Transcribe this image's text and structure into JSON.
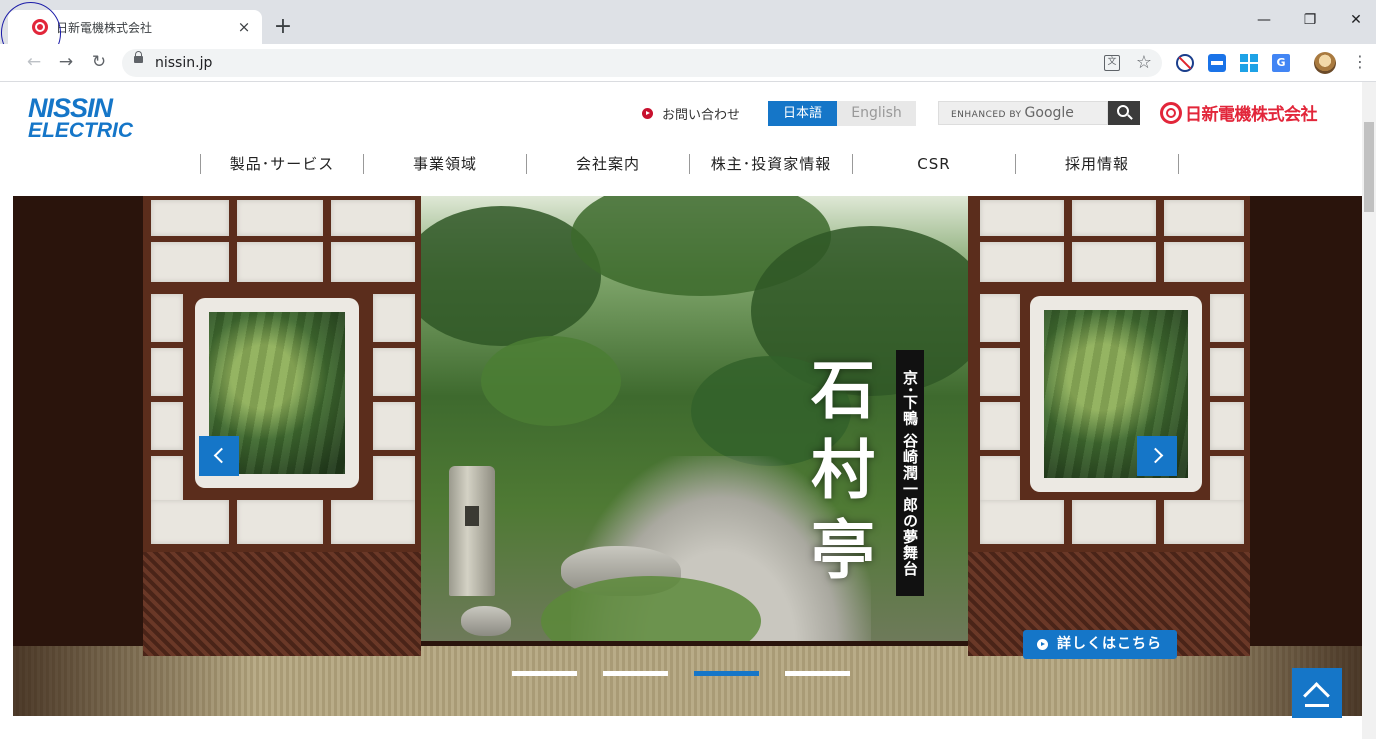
{
  "browser": {
    "tab_title": "日新電機株式会社",
    "tab_close": "×",
    "new_tab": "+",
    "url": "nissin.jp",
    "back": "←",
    "forward": "→",
    "reload": "↻",
    "star": "☆",
    "translate": "文",
    "minimize": "—",
    "restore": "❐",
    "close": "✕",
    "menu": "⋮",
    "ext_translate_label": "G"
  },
  "header": {
    "logo_line1": "NISSIN",
    "logo_line2": "ELECTRIC",
    "contact": "お問い合わせ",
    "lang_ja": "日本語",
    "lang_en": "English",
    "search_enhanced": "ENHANCED BY",
    "search_google": "Google",
    "corp_name": "日新電機株式会社"
  },
  "nav": {
    "items": [
      {
        "label": "製品･サービス"
      },
      {
        "label": "事業領域"
      },
      {
        "label": "会社案内"
      },
      {
        "label": "株主･投資家情報"
      },
      {
        "label": "CSR"
      },
      {
        "label": "採用情報"
      }
    ]
  },
  "hero": {
    "caption_sub": "京･下鴨 谷崎潤一郎の夢舞台",
    "caption_main": "石村亭",
    "more_button": "詳しくはこちら",
    "slide_count": 4,
    "active_slide": 3
  },
  "colors": {
    "brand_blue": "#1576c8",
    "brand_red": "#e2263a"
  }
}
